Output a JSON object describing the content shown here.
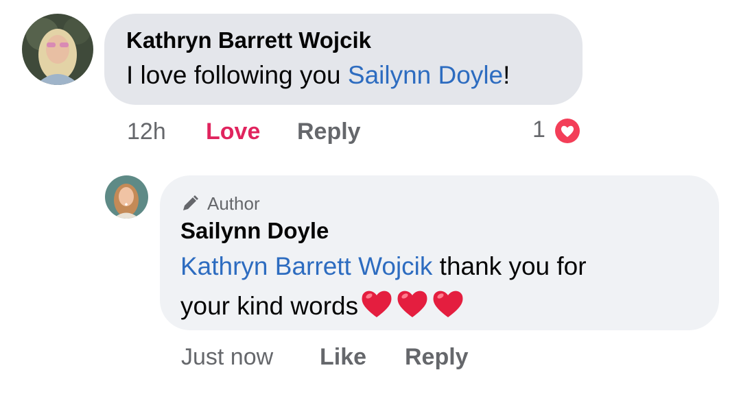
{
  "comment": {
    "author": "Kathryn Barrett Wojcik",
    "text_before": "I love following you ",
    "mention": "Sailynn Doyle",
    "text_after": "!",
    "time": "12h",
    "love_label": "Love",
    "reply_label": "Reply",
    "reaction_count": "1",
    "reaction_icon": "heart-reaction-icon"
  },
  "reply": {
    "badge_icon": "pencil-icon",
    "badge_label": "Author",
    "author": "Sailynn Doyle",
    "mention": "Kathryn Barrett Wojcik",
    "line1_text": " thank you for",
    "line2_text": "your kind words",
    "emoji": "heart-emoji-icon",
    "emoji_count": 3,
    "time": "Just now",
    "like_label": "Like",
    "reply_label": "Reply"
  },
  "colors": {
    "mention": "#2d6cc0",
    "love_active": "#e0245e",
    "meta_text": "#65676b",
    "bubble_comment": "#e4e6eb",
    "bubble_reply": "#f0f2f5",
    "heart": "#e41e3f"
  }
}
